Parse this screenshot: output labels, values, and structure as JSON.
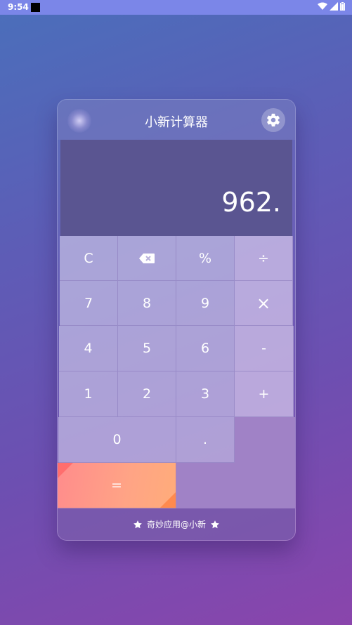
{
  "status_bar": {
    "time": "9:54"
  },
  "app": {
    "title": "小新计算器"
  },
  "display": {
    "value": "962."
  },
  "keys": {
    "clear": "C",
    "percent": "%",
    "divide": "÷",
    "seven": "7",
    "eight": "8",
    "nine": "9",
    "multiply": "×",
    "four": "4",
    "five": "5",
    "six": "6",
    "minus": "-",
    "one": "1",
    "two": "2",
    "three": "3",
    "plus": "+",
    "zero": "0",
    "decimal": ".",
    "equals": "="
  },
  "footer": {
    "text": "奇妙应用@小新"
  },
  "icons": {
    "settings": "gear-icon",
    "backspace": "backspace-icon",
    "footer": "star-icon"
  },
  "colors": {
    "display_bg": "#5a5591",
    "equals_gradient_start": "#ff8c8c",
    "equals_gradient_end": "#ffac7a",
    "accent_empty_cell": "#a082c6"
  }
}
